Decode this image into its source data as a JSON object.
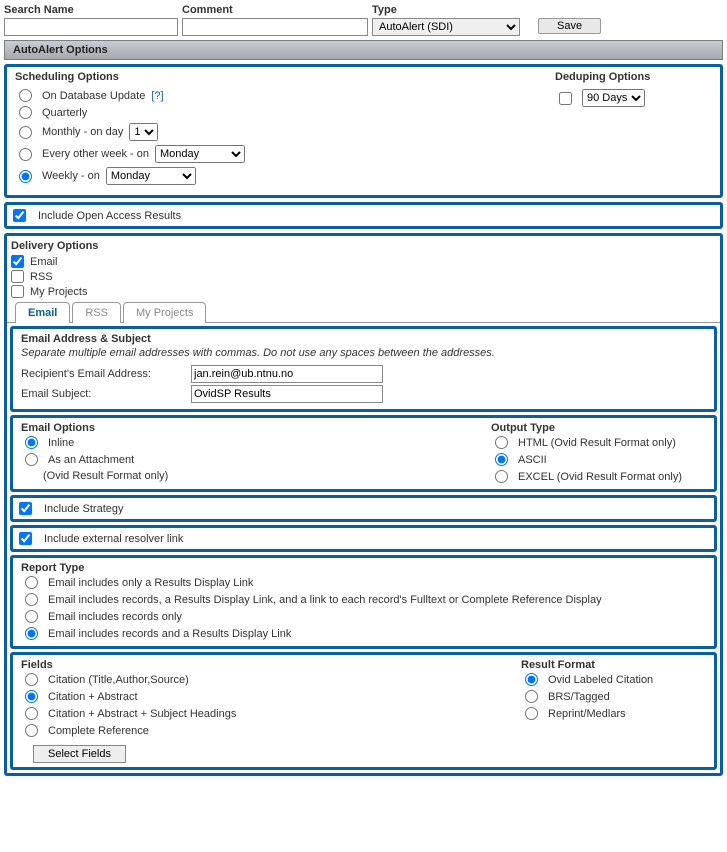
{
  "top": {
    "searchNameLabel": "Search Name",
    "commentLabel": "Comment",
    "typeLabel": "Type",
    "typeValue": "AutoAlert (SDI)",
    "saveLabel": "Save"
  },
  "sectionHeader": "AutoAlert Options",
  "scheduling": {
    "title": "Scheduling Options",
    "dbUpdate": "On Database Update",
    "helpMark": "[?]",
    "quarterly": "Quarterly",
    "monthlyPrefix": "Monthly - on day",
    "monthlyDay": "1",
    "eowPrefix": "Every other week - on",
    "eowDay": "Monday",
    "weeklyPrefix": "Weekly - on",
    "weeklyDay": "Monday"
  },
  "deduping": {
    "title": "Deduping Options",
    "value": "90 Days"
  },
  "includeOpenAccess": "Include Open Access Results",
  "delivery": {
    "title": "Delivery Options",
    "emailChk": "Email",
    "rssChk": "RSS",
    "myProjectsChk": "My Projects",
    "tabs": {
      "email": "Email",
      "rss": "RSS",
      "myprojects": "My Projects"
    }
  },
  "emailAddr": {
    "title": "Email Address & Subject",
    "hint": "Separate multiple email addresses with commas. Do not use any spaces between the addresses.",
    "recipLabel": "Recipient's Email Address:",
    "recipValue": "jan.rein@ub.ntnu.no",
    "subjLabel": "Email Subject:",
    "subjValue": "OvidSP Results"
  },
  "emailOptions": {
    "title": "Email Options",
    "inline": "Inline",
    "attach": "As an Attachment",
    "attachNote": "(Ovid Result Format only)",
    "outputTitle": "Output Type",
    "html": "HTML (Ovid Result Format only)",
    "ascii": "ASCII",
    "excel": "EXCEL (Ovid Result Format only)"
  },
  "includeStrategy": "Include Strategy",
  "includeResolver": "Include external resolver link",
  "reportType": {
    "title": "Report Type",
    "opt1": "Email includes only a Results Display Link",
    "opt2": "Email includes records, a Results Display Link, and a link to each record's Fulltext or Complete Reference Display",
    "opt3": "Email includes records only",
    "opt4": "Email includes records and a Results Display Link"
  },
  "fields": {
    "title": "Fields",
    "f1": "Citation (Title,Author,Source)",
    "f2": "Citation + Abstract",
    "f3": "Citation + Abstract + Subject Headings",
    "f4": "Complete Reference",
    "selectBtn": "Select Fields",
    "resultTitle": "Result Format",
    "r1": "Ovid Labeled Citation",
    "r2": "BRS/Tagged",
    "r3": "Reprint/Medlars"
  }
}
